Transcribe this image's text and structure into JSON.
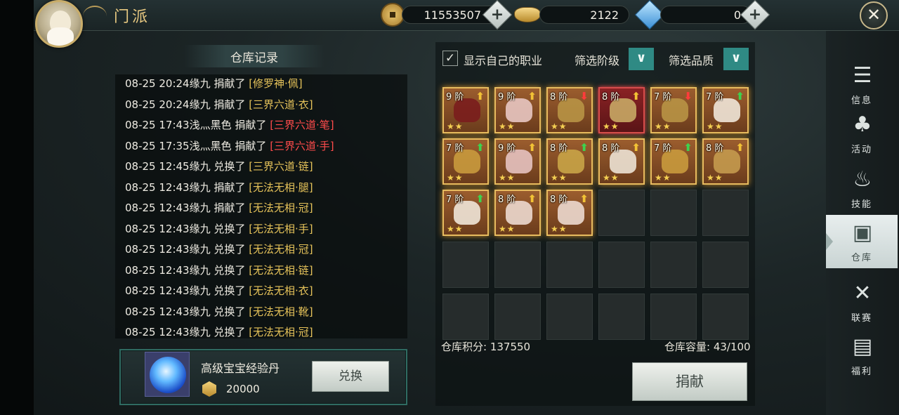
{
  "header": {
    "title": "门派",
    "copper": "11553507",
    "gold": "2122",
    "diamond": "0"
  },
  "records": {
    "title": "仓库记录",
    "rows": [
      {
        "time": "08-25 20:24",
        "user": "缘九",
        "action": "捐献了",
        "item": "[修罗神·佩]",
        "red": false
      },
      {
        "time": "08-25 20:24",
        "user": "缘九",
        "action": "捐献了",
        "item": "[三界六道·衣]",
        "red": false
      },
      {
        "time": "08-25 17:43",
        "user": "浅灬黑色",
        "action": "捐献了",
        "item": "[三界六道·笔]",
        "red": true
      },
      {
        "time": "08-25 17:35",
        "user": "浅灬黑色",
        "action": "捐献了",
        "item": "[三界六道·手]",
        "red": true
      },
      {
        "time": "08-25 12:45",
        "user": "缘九",
        "action": "兑换了",
        "item": "[三界六道·链]",
        "red": false
      },
      {
        "time": "08-25 12:43",
        "user": "缘九",
        "action": "捐献了",
        "item": "[无法无相·腿]",
        "red": false
      },
      {
        "time": "08-25 12:43",
        "user": "缘九",
        "action": "捐献了",
        "item": "[无法无相·冠]",
        "red": false
      },
      {
        "time": "08-25 12:43",
        "user": "缘九",
        "action": "兑换了",
        "item": "[无法无相·手]",
        "red": false
      },
      {
        "time": "08-25 12:43",
        "user": "缘九",
        "action": "兑换了",
        "item": "[无法无相·冠]",
        "red": false
      },
      {
        "time": "08-25 12:43",
        "user": "缘九",
        "action": "兑换了",
        "item": "[无法无相·链]",
        "red": false
      },
      {
        "time": "08-25 12:43",
        "user": "缘九",
        "action": "兑换了",
        "item": "[无法无相·衣]",
        "red": false
      },
      {
        "time": "08-25 12:43",
        "user": "缘九",
        "action": "兑换了",
        "item": "[无法无相·靴]",
        "red": false
      },
      {
        "time": "08-25 12:43",
        "user": "缘九",
        "action": "兑换了",
        "item": "[无法无相·冠]",
        "red": false
      }
    ]
  },
  "reward": {
    "name": "高级宝宝经验丹",
    "cost": "20000",
    "button": "兑换"
  },
  "warehouse": {
    "show_class_label": "显示自己的职业",
    "show_class_checked": "✓",
    "filter_tier_label": "筛选阶级",
    "filter_quality_label": "筛选品质",
    "filter_icon": "chevron-down-icon",
    "score_text": "仓库积分: 137550",
    "capacity_text": "仓库容量: 43/100",
    "donate_button": "捐献",
    "items": [
      {
        "tier": "9 阶",
        "arrow": "up-yellow",
        "art": "#7a1d1d",
        "red": false
      },
      {
        "tier": "9 阶",
        "arrow": "up-yellow",
        "art": "#e8c7c2",
        "red": false
      },
      {
        "tier": "8 阶",
        "arrow": "down-red",
        "art": "#b89445",
        "red": false
      },
      {
        "tier": "8 阶",
        "arrow": "up-yellow",
        "art": "#c8a865",
        "red": true
      },
      {
        "tier": "7 阶",
        "arrow": "down-red",
        "art": "#b89445",
        "red": false
      },
      {
        "tier": "7 阶",
        "arrow": "up-green",
        "art": "#efe6d8",
        "red": false
      },
      {
        "tier": "7 阶",
        "arrow": "up-green",
        "art": "#c99a3d",
        "red": false
      },
      {
        "tier": "9 阶",
        "arrow": "up-yellow",
        "art": "#e6c2c0",
        "red": false
      },
      {
        "tier": "8 阶",
        "arrow": "up-green",
        "art": "#c9a447",
        "red": false
      },
      {
        "tier": "8 阶",
        "arrow": "up-yellow",
        "art": "#ece2d4",
        "red": false
      },
      {
        "tier": "7 阶",
        "arrow": "up-green",
        "art": "#c99a3d",
        "red": false
      },
      {
        "tier": "8 阶",
        "arrow": "up-yellow",
        "art": "#c49a4e",
        "red": false
      },
      {
        "tier": "7 阶",
        "arrow": "up-green",
        "art": "#efe6d8",
        "red": false
      },
      {
        "tier": "8 阶",
        "arrow": "up-yellow",
        "art": "#ecd9cf",
        "red": false
      },
      {
        "tier": "8 阶",
        "arrow": "up-yellow",
        "art": "#ecd9cf",
        "red": false
      }
    ],
    "empty_slots": 15,
    "stars": "★★"
  },
  "menu": [
    {
      "label": "信息",
      "icon": "info-icon",
      "glyph": "☰",
      "active": false
    },
    {
      "label": "活动",
      "icon": "gourd-icon",
      "glyph": "♣",
      "active": false
    },
    {
      "label": "技能",
      "icon": "lotus-fire-icon",
      "glyph": "♨",
      "active": false
    },
    {
      "label": "仓库",
      "icon": "chest-icon",
      "glyph": "▣",
      "active": true
    },
    {
      "label": "联赛",
      "icon": "crossed-swords-icon",
      "glyph": "✕",
      "active": false
    },
    {
      "label": "福利",
      "icon": "gift-chest-icon",
      "glyph": "▤",
      "active": false
    }
  ]
}
